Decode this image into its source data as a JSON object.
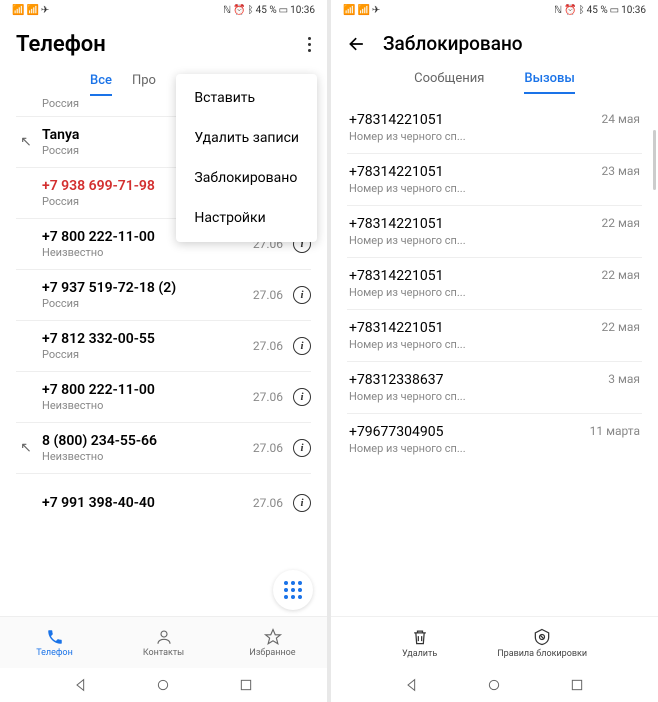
{
  "status": {
    "battery": "45 %",
    "time": "10:36"
  },
  "left": {
    "title": "Телефон",
    "tabs": {
      "all": "Все",
      "missed": "Про"
    },
    "menu": {
      "paste": "Вставить",
      "delete": "Удалить записи",
      "blocked": "Заблокировано",
      "settings": "Настройки"
    },
    "rows": [
      {
        "sub": "Россия"
      },
      {
        "title": "Tanya",
        "sub": "Россия",
        "icon": "out"
      },
      {
        "title": "+7 938 699-71-98",
        "sub": "Россия",
        "red": true
      },
      {
        "title": "+7 800 222-11-00",
        "sub": "Неизвестно",
        "date": "27.06"
      },
      {
        "title": "+7 937 519-72-18 (2)",
        "sub": "Россия",
        "date": "27.06"
      },
      {
        "title": "+7 812 332-00-55",
        "sub": "Россия",
        "date": "27.06"
      },
      {
        "title": "+7 800 222-11-00",
        "sub": "Неизвестно",
        "date": "27.06"
      },
      {
        "title": "8 (800) 234-55-66",
        "sub": "Неизвестно",
        "date": "27.06",
        "icon": "out"
      },
      {
        "title": "+7 991 398-40-40",
        "sub": "",
        "date": "27.06"
      }
    ],
    "nav": {
      "phone": "Телефон",
      "contacts": "Контакты",
      "fav": "Избранное"
    }
  },
  "right": {
    "title": "Заблокировано",
    "tabs": {
      "messages": "Сообщения",
      "calls": "Вызовы"
    },
    "sub": "Номер из черного сп...",
    "rows": [
      {
        "number": "+78314221051",
        "date": "24 мая"
      },
      {
        "number": "+78314221051",
        "date": "23 мая"
      },
      {
        "number": "+78314221051",
        "date": "22 мая"
      },
      {
        "number": "+78314221051",
        "date": "22 мая"
      },
      {
        "number": "+78314221051",
        "date": "22 мая"
      },
      {
        "number": "+78312338637",
        "date": "3 мая"
      },
      {
        "number": "+79677304905",
        "date": "11 марта"
      }
    ],
    "actions": {
      "delete": "Удалить",
      "rules": "Правила блокировки"
    }
  }
}
